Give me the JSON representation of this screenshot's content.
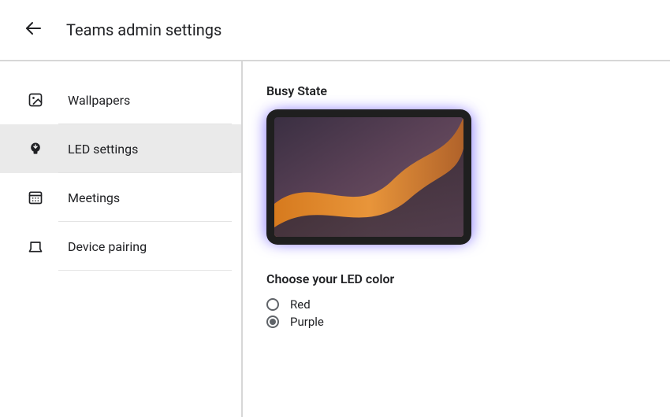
{
  "header": {
    "title": "Teams admin settings"
  },
  "sidebar": {
    "items": [
      {
        "label": "Wallpapers",
        "icon": "image-icon",
        "selected": false
      },
      {
        "label": "LED settings",
        "icon": "lightbulb-icon",
        "selected": true
      },
      {
        "label": "Meetings",
        "icon": "calendar-icon",
        "selected": false
      },
      {
        "label": "Device pairing",
        "icon": "device-icon",
        "selected": false
      }
    ]
  },
  "main": {
    "busy_state_title": "Busy State",
    "choose_color_title": "Choose your LED color",
    "led_glow_color": "#7a6bff",
    "color_options": [
      {
        "label": "Red",
        "selected": false
      },
      {
        "label": "Purple",
        "selected": true
      }
    ]
  }
}
